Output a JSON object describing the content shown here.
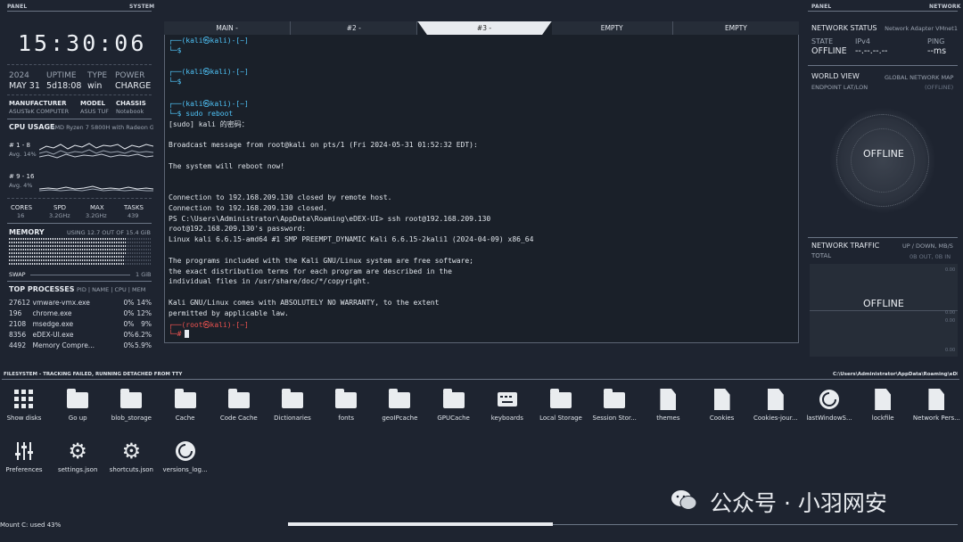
{
  "left_panel": {
    "header_left": "PANEL",
    "header_right": "SYSTEM",
    "clock": "15:30:06",
    "sysinfo": {
      "year": "2024",
      "date": "MAY 31",
      "uptime_label": "UPTIME",
      "uptime": "5d18:08",
      "type_label": "TYPE",
      "type": "win",
      "power_label": "POWER",
      "power": "CHARGE"
    },
    "hardware": {
      "manufacturer_label": "MANUFACTURER",
      "manufacturer": "ASUSTeK COMPUTER",
      "model_label": "MODEL",
      "model": "ASUS TUF",
      "chassis_label": "CHASSIS",
      "chassis": "Notebook"
    },
    "cpu": {
      "title": "CPU USAGE",
      "name": "AMD Ryzen 7 5800H with Radeon G",
      "group1_label": "# 1 - 8",
      "group1_avg": "Avg. 14%",
      "group2_label": "# 9 - 16",
      "group2_avg": "Avg. 4%",
      "cores_label": "CORES",
      "cores": "16",
      "spd_label": "SPD",
      "spd": "3.2GHz",
      "max_label": "MAX",
      "max": "3.2GHz",
      "tasks_label": "TASKS",
      "tasks": "439"
    },
    "memory": {
      "title": "MEMORY",
      "usage": "USING 12.7 OUT OF 15.4 GiB",
      "used_fraction": 0.82,
      "swap_label": "SWAP",
      "swap_value": "1 GiB"
    },
    "processes": {
      "title": "TOP PROCESSES",
      "columns": "PID | NAME | CPU | MEM",
      "rows": [
        {
          "pid": "27612",
          "name": "vmware-vmx.exe",
          "cpu": "0%",
          "mem": "14%"
        },
        {
          "pid": "196",
          "name": "chrome.exe",
          "cpu": "0%",
          "mem": "12%"
        },
        {
          "pid": "2108",
          "name": "msedge.exe",
          "cpu": "0%",
          "mem": "9%"
        },
        {
          "pid": "8356",
          "name": "eDEX-UI.exe",
          "cpu": "0%",
          "mem": "6.2%"
        },
        {
          "pid": "4492",
          "name": "Memory Compre...",
          "cpu": "0%",
          "mem": "5.9%"
        }
      ]
    }
  },
  "terminal": {
    "tabs": [
      "MAIN -",
      "#2 -",
      "#3 -",
      "EMPTY",
      "EMPTY"
    ],
    "active_tab": 2,
    "lines": [
      {
        "t": "┌──(kali㉿kali)-[~]",
        "c": "prompt"
      },
      {
        "t": "└─$",
        "c": "prompt"
      },
      {
        "t": "",
        "c": ""
      },
      {
        "t": "┌──(kali㉿kali)-[~]",
        "c": "prompt"
      },
      {
        "t": "└─$",
        "c": "prompt"
      },
      {
        "t": "",
        "c": ""
      },
      {
        "t": "┌──(kali㉿kali)-[~]",
        "c": "prompt"
      },
      {
        "t": "└─$ sudo reboot",
        "c": "prompt"
      },
      {
        "t": "[sudo] kali 的密码：",
        "c": ""
      },
      {
        "t": "",
        "c": ""
      },
      {
        "t": "Broadcast message from root@kali on pts/1 (Fri 2024-05-31 01:52:32 EDT):",
        "c": ""
      },
      {
        "t": "",
        "c": ""
      },
      {
        "t": "The system will reboot now!",
        "c": ""
      },
      {
        "t": "",
        "c": ""
      },
      {
        "t": "",
        "c": ""
      },
      {
        "t": "Connection to 192.168.209.130 closed by remote host.",
        "c": ""
      },
      {
        "t": "Connection to 192.168.209.130 closed.",
        "c": ""
      },
      {
        "t": "PS C:\\Users\\Administrator\\AppData\\Roaming\\eDEX-UI> ssh root@192.168.209.130",
        "c": ""
      },
      {
        "t": "root@192.168.209.130's password:",
        "c": ""
      },
      {
        "t": "Linux kali 6.6.15-amd64 #1 SMP PREEMPT_DYNAMIC Kali 6.6.15-2kali1 (2024-04-09) x86_64",
        "c": ""
      },
      {
        "t": "",
        "c": ""
      },
      {
        "t": "The programs included with the Kali GNU/Linux system are free software;",
        "c": ""
      },
      {
        "t": "the exact distribution terms for each program are described in the",
        "c": ""
      },
      {
        "t": "individual files in /usr/share/doc/*/copyright.",
        "c": ""
      },
      {
        "t": "",
        "c": ""
      },
      {
        "t": "Kali GNU/Linux comes with ABSOLUTELY NO WARRANTY, to the extent",
        "c": ""
      },
      {
        "t": "permitted by applicable law.",
        "c": ""
      },
      {
        "t": "┌──(root㉿kali)-[~]",
        "c": "root"
      },
      {
        "t": "└─#",
        "c": "root"
      }
    ]
  },
  "right_panel": {
    "header_left": "PANEL",
    "header_right": "NETWORK",
    "network_status": {
      "title": "NETWORK STATUS",
      "adapter": "Network Adapter VMnet1",
      "state_label": "STATE",
      "state": "OFFLINE",
      "ipv4_label": "IPv4",
      "ipv4": "--.--.--.--",
      "ping_label": "PING",
      "ping": "--ms"
    },
    "world_view": {
      "title": "WORLD VIEW",
      "subtitle": "GLOBAL NETWORK MAP",
      "endpoint_label": "ENDPOINT LAT/LON",
      "endpoint_value": "(OFFLINE)",
      "overlay": "OFFLINE"
    },
    "traffic": {
      "title": "NETWORK TRAFFIC",
      "units": "UP / DOWN, MB/S",
      "total_label": "TOTAL",
      "total_value": "0B OUT, 0B IN",
      "overlay": "OFFLINE",
      "scale": [
        "0.00",
        "0.00",
        "0.00",
        "0.00"
      ]
    }
  },
  "filesystem": {
    "header_left": "FILESYSTEM - TRACKING FAILED, RUNNING DETACHED FROM TTY",
    "header_right": "C:\\Users\\Administrator\\AppData\\Roaming\\eDEX-UI",
    "items": [
      {
        "label": "Show disks",
        "icon": "grid-icon"
      },
      {
        "label": "Go up",
        "icon": "folder-up-icon"
      },
      {
        "label": "blob_storage",
        "icon": "folder-icon"
      },
      {
        "label": "Cache",
        "icon": "folder-icon"
      },
      {
        "label": "Code Cache",
        "icon": "folder-icon"
      },
      {
        "label": "Dictionaries",
        "icon": "folder-icon"
      },
      {
        "label": "fonts",
        "icon": "folder-icon"
      },
      {
        "label": "geoIPcache",
        "icon": "folder-icon"
      },
      {
        "label": "GPUCache",
        "icon": "folder-icon"
      },
      {
        "label": "keyboards",
        "icon": "keyboard-icon"
      },
      {
        "label": "Local Storage",
        "icon": "folder-icon"
      },
      {
        "label": "Session Stor...",
        "icon": "folder-icon"
      },
      {
        "label": "themes",
        "icon": "themes-icon"
      },
      {
        "label": "Cookies",
        "icon": "file-icon"
      },
      {
        "label": "Cookies-jour...",
        "icon": "file-icon"
      },
      {
        "label": "lastWindowS...",
        "icon": "edex-icon"
      },
      {
        "label": "lockfile",
        "icon": "file-icon"
      },
      {
        "label": "Network Pers...",
        "icon": "file-icon"
      },
      {
        "label": "Preferences",
        "icon": "sliders-icon"
      },
      {
        "label": "settings.json",
        "icon": "gear-icon"
      },
      {
        "label": "shortcuts.json",
        "icon": "gear-icon"
      },
      {
        "label": "versions_log...",
        "icon": "edex-icon"
      }
    ],
    "mount_status": "Mount C: used 43%"
  },
  "watermark": "公众号 · 小羽网安"
}
